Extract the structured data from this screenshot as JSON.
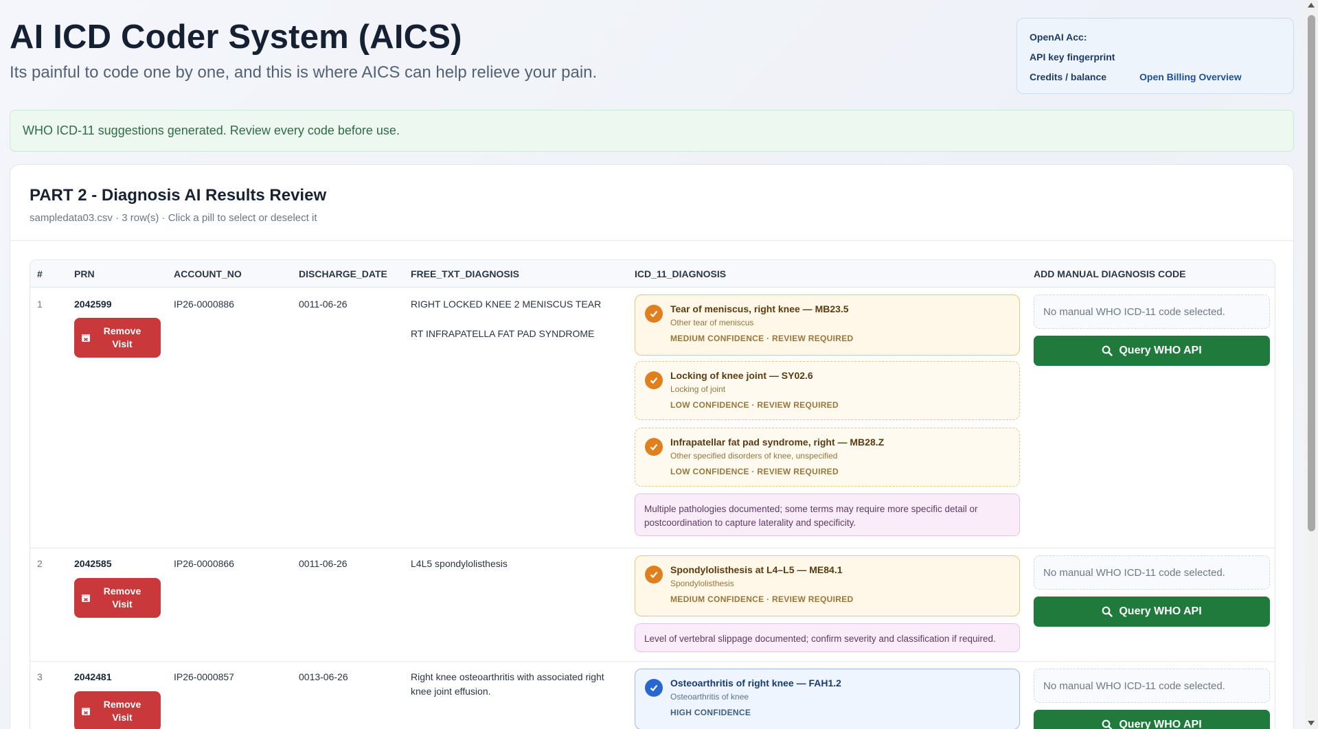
{
  "header": {
    "title": "AI ICD Coder System (AICS)",
    "subtitle": "Its painful to code one by one, and this is where AICS can help relieve your pain."
  },
  "account": {
    "openai_label": "OpenAI Acc:",
    "fingerprint_label": "API key fingerprint",
    "credits_label": "Credits / balance",
    "billing_link": "Open Billing Overview"
  },
  "banner": {
    "message": "WHO ICD-11 suggestions generated. Review every code before use."
  },
  "review": {
    "title": "PART 2 - Diagnosis AI Results Review",
    "meta": "sampledata03.csv · 3 row(s) · Click a pill to select or deselect it",
    "columns": [
      "#",
      "PRN",
      "ACCOUNT_NO",
      "DISCHARGE_DATE",
      "FREE_TXT_DIAGNOSIS",
      "ICD_11_DIAGNOSIS",
      "ADD MANUAL DIAGNOSIS CODE"
    ],
    "remove_line1": "Remove",
    "remove_line2": "Visit",
    "manual_placeholder": "No manual WHO ICD-11 code selected.",
    "query_label": "Query WHO API",
    "rows": [
      {
        "num": "1",
        "prn": "2042599",
        "account_no": "IP26-0000886",
        "discharge_date": "0011-06-26",
        "free_text": [
          "RIGHT LOCKED KNEE 2 MENISCUS TEAR",
          "RT INFRAPATELLA FAT PAD SYNDROME"
        ],
        "suggestions": [
          {
            "title": "Tear of meniscus, right knee — MB23.5",
            "subtitle": "Other tear of meniscus",
            "confidence": "MEDIUM CONFIDENCE · REVIEW REQUIRED",
            "level": "medium"
          },
          {
            "title": "Locking of knee joint — SY02.6",
            "subtitle": "Locking of joint",
            "confidence": "LOW CONFIDENCE · REVIEW REQUIRED",
            "level": "low"
          },
          {
            "title": "Infrapatellar fat pad syndrome, right — MB28.Z",
            "subtitle": "Other specified disorders of knee, unspecified",
            "confidence": "LOW CONFIDENCE · REVIEW REQUIRED",
            "level": "low"
          }
        ],
        "note": "Multiple pathologies documented; some terms may require more specific detail or postcoordination to capture laterality and specificity."
      },
      {
        "num": "2",
        "prn": "2042585",
        "account_no": "IP26-0000866",
        "discharge_date": "0011-06-26",
        "free_text": [
          "L4L5 spondylolisthesis"
        ],
        "suggestions": [
          {
            "title": "Spondylolisthesis at L4–L5 — ME84.1",
            "subtitle": "Spondylolisthesis",
            "confidence": "MEDIUM CONFIDENCE · REVIEW REQUIRED",
            "level": "medium"
          }
        ],
        "note": "Level of vertebral slippage documented; confirm severity and classification if required."
      },
      {
        "num": "3",
        "prn": "2042481",
        "account_no": "IP26-0000857",
        "discharge_date": "0013-06-26",
        "free_text": [
          "Right knee osteoarthritis with associated right knee joint effusion."
        ],
        "suggestions": [
          {
            "title": "Osteoarthritis of right knee — FAH1.2",
            "subtitle": "Osteoarthritis of knee",
            "confidence": "HIGH CONFIDENCE",
            "level": "high"
          }
        ],
        "note": ""
      }
    ]
  },
  "colors": {
    "remove_button": "#c9383a",
    "query_button": "#1f7a3c",
    "medium_check": "#df7f1d",
    "high_check": "#2767cf"
  }
}
